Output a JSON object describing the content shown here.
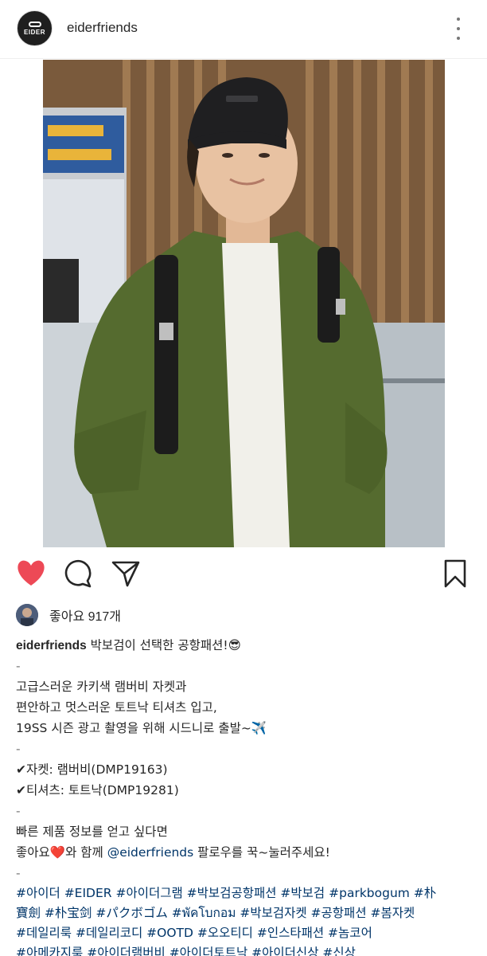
{
  "post": {
    "username": "eiderfriends",
    "avatar_brand": "EIDER",
    "likes_text": "좋아요 917개",
    "caption_title": "박보검이 선택한 공항패션!😎",
    "dash": "-",
    "desc_line1": "고급스러운 카키색 램버비 자켓과",
    "desc_line2": "편안하고 멋스러운 토트낙 티셔츠 입고,",
    "desc_line3": "19SS 시즌 광고 촬영을 위해 시드니로 출발~✈️",
    "item1": "✔자켓: 램버비(DMP19163)",
    "item2": "✔티셔츠: 토트낙(DMP19281)",
    "cta_line1": "빠른 제품 정보를 얻고 싶다면",
    "cta_line2_pre": "좋아요❤️와 함께 ",
    "cta_mention": "@eiderfriends",
    "cta_line2_post": " 팔로우를 꾹~눌러주세요!",
    "hashtag_lines": [
      "#아이더 #EIDER #아이더그램 #박보검공항패션 #박보검 #parkbogum #朴",
      "寶劍 #朴宝剑 #パクボゴム #พัคโบกอม #박보검자켓 #공항패션 #봄자켓",
      "#데일리룩 #데일리코디 #OOTD #오오티디 #인스타패션 #놈코어",
      "#아메카지룩 #아이더램버비 #아이더토트낙 #아이더신상 #신상"
    ]
  },
  "icons": {
    "like": "heart-filled-icon",
    "comment": "comment-icon",
    "share": "send-icon",
    "save": "bookmark-icon",
    "more": "more-vertical-icon"
  },
  "colors": {
    "like_red": "#ed4956",
    "link_blue": "#003569",
    "text": "#262626"
  }
}
